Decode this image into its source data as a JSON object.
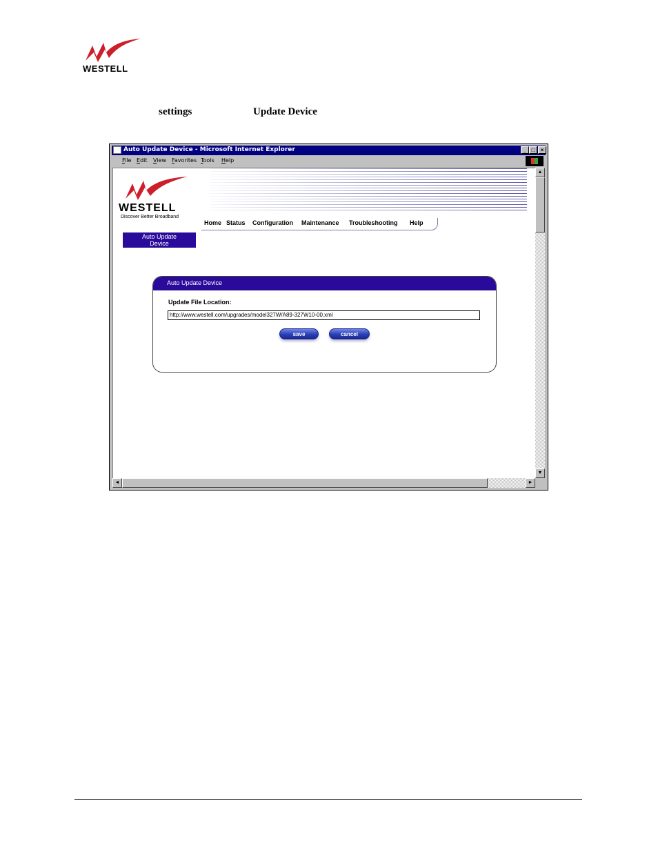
{
  "document": {
    "logo_text": "WESTELL",
    "instruction_words": [
      "settings",
      "Update Device"
    ]
  },
  "browser": {
    "title": "Auto Update Device - Microsoft Internet Explorer",
    "window_buttons": [
      "_",
      "□",
      "×"
    ],
    "menu": [
      "File",
      "Edit",
      "View",
      "Favorites",
      "Tools",
      "Help"
    ],
    "scroll_arrows": {
      "up": "▲",
      "down": "▼",
      "left": "◄",
      "right": "►"
    }
  },
  "page": {
    "brand": {
      "name": "WESTELL",
      "tagline": "Discover Better Broadband"
    },
    "nav": [
      "Home",
      "Status",
      "Configuration",
      "Maintenance",
      "Troubleshooting",
      "Help"
    ],
    "side_tab": {
      "line1": "Auto Update",
      "line2": "Device"
    },
    "panel": {
      "title": "Auto Update Device",
      "field_label": "Update File Location:",
      "field_value": "http://www.westell.com/upgrades/model327W/A89-327W10-00.xml",
      "save_label": "save",
      "cancel_label": "cancel"
    }
  },
  "colors": {
    "accent": "#2a0a9a",
    "brand_red": "#cc1f2a",
    "titlebar": "#000080"
  }
}
